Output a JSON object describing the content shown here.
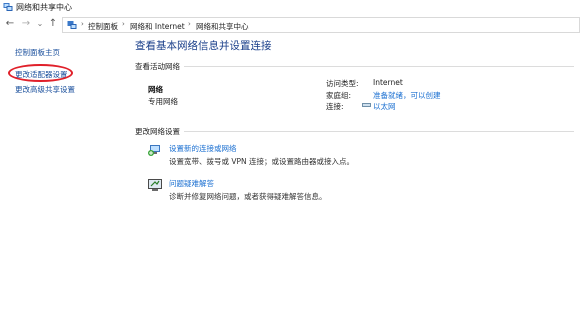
{
  "window": {
    "title": "网络和共享中心"
  },
  "nav": {
    "back_glyph": "←",
    "forward_glyph": "→",
    "dropdown_glyph": "⌄",
    "up_glyph": "↑"
  },
  "breadcrumb": {
    "items": [
      "控制面板",
      "网络和 Internet",
      "网络和共享中心"
    ],
    "separator": "›"
  },
  "sidebar": {
    "items": [
      {
        "label": "控制面板主页"
      },
      {
        "label": "更改适配器设置"
      },
      {
        "label": "更改高级共享设置"
      }
    ]
  },
  "main": {
    "title": "查看基本网络信息并设置连接",
    "active_section": "查看活动网络",
    "network": {
      "name": "网络",
      "type": "专用网络",
      "access_label": "访问类型:",
      "access_value": "Internet",
      "homegroup_label": "家庭组:",
      "homegroup_value": "准备就绪，可以创建",
      "connection_label": "连接:",
      "connection_value": "以太网"
    },
    "change_section": "更改网络设置",
    "tasks": [
      {
        "title": "设置新的连接或网络",
        "desc": "设置宽带、拨号或 VPN 连接；或设置路由器或接入点。"
      },
      {
        "title": "问题疑难解答",
        "desc": "诊断并修复网络问题，或者获得疑难解答信息。"
      }
    ]
  },
  "colors": {
    "link": "#1a6fd1",
    "side_link": "#1a4f9c",
    "title": "#1a3f8a",
    "highlight": "#e0202a"
  }
}
